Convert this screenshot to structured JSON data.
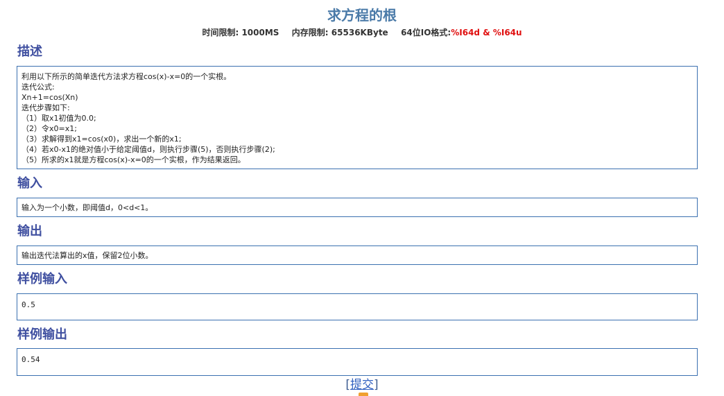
{
  "problem": {
    "title": "求方程的根",
    "limits": {
      "time_label": "时间限制:",
      "time_value": "1000MS",
      "memory_label": "内存限制:",
      "memory_value": "65536KByte",
      "io_label": "64位IO格式:",
      "io_value": "%I64d & %I64u"
    }
  },
  "sections": {
    "description": {
      "heading": "描述",
      "lines": [
        "利用以下所示的简单迭代方法求方程cos(x)-x=0的一个实根。",
        "迭代公式:",
        "Xn+1=cos(Xn)",
        "迭代步骤如下:",
        "（1）取x1初值为0.0;",
        "（2）令x0=x1;",
        "（3）求解得到x1=cos(x0)，求出一个新的x1;",
        "（4）若x0-x1的绝对值小于给定阈值d，则执行步骤(5)，否则执行步骤(2);",
        "（5）所求的x1就是方程cos(x)-x=0的一个实根，作为结果返回。"
      ]
    },
    "input": {
      "heading": "输入",
      "text": "输入为一个小数，即阈值d，0<d<1。"
    },
    "output": {
      "heading": "输出",
      "text": "输出迭代法算出的x值，保留2位小数。"
    },
    "sample_input": {
      "heading": "样例输入",
      "text": "0.5"
    },
    "sample_output": {
      "heading": "样例输出",
      "text": "0.54"
    }
  },
  "actions": {
    "bracket_open": "[",
    "submit_label": "提交",
    "bracket_close": "]"
  }
}
